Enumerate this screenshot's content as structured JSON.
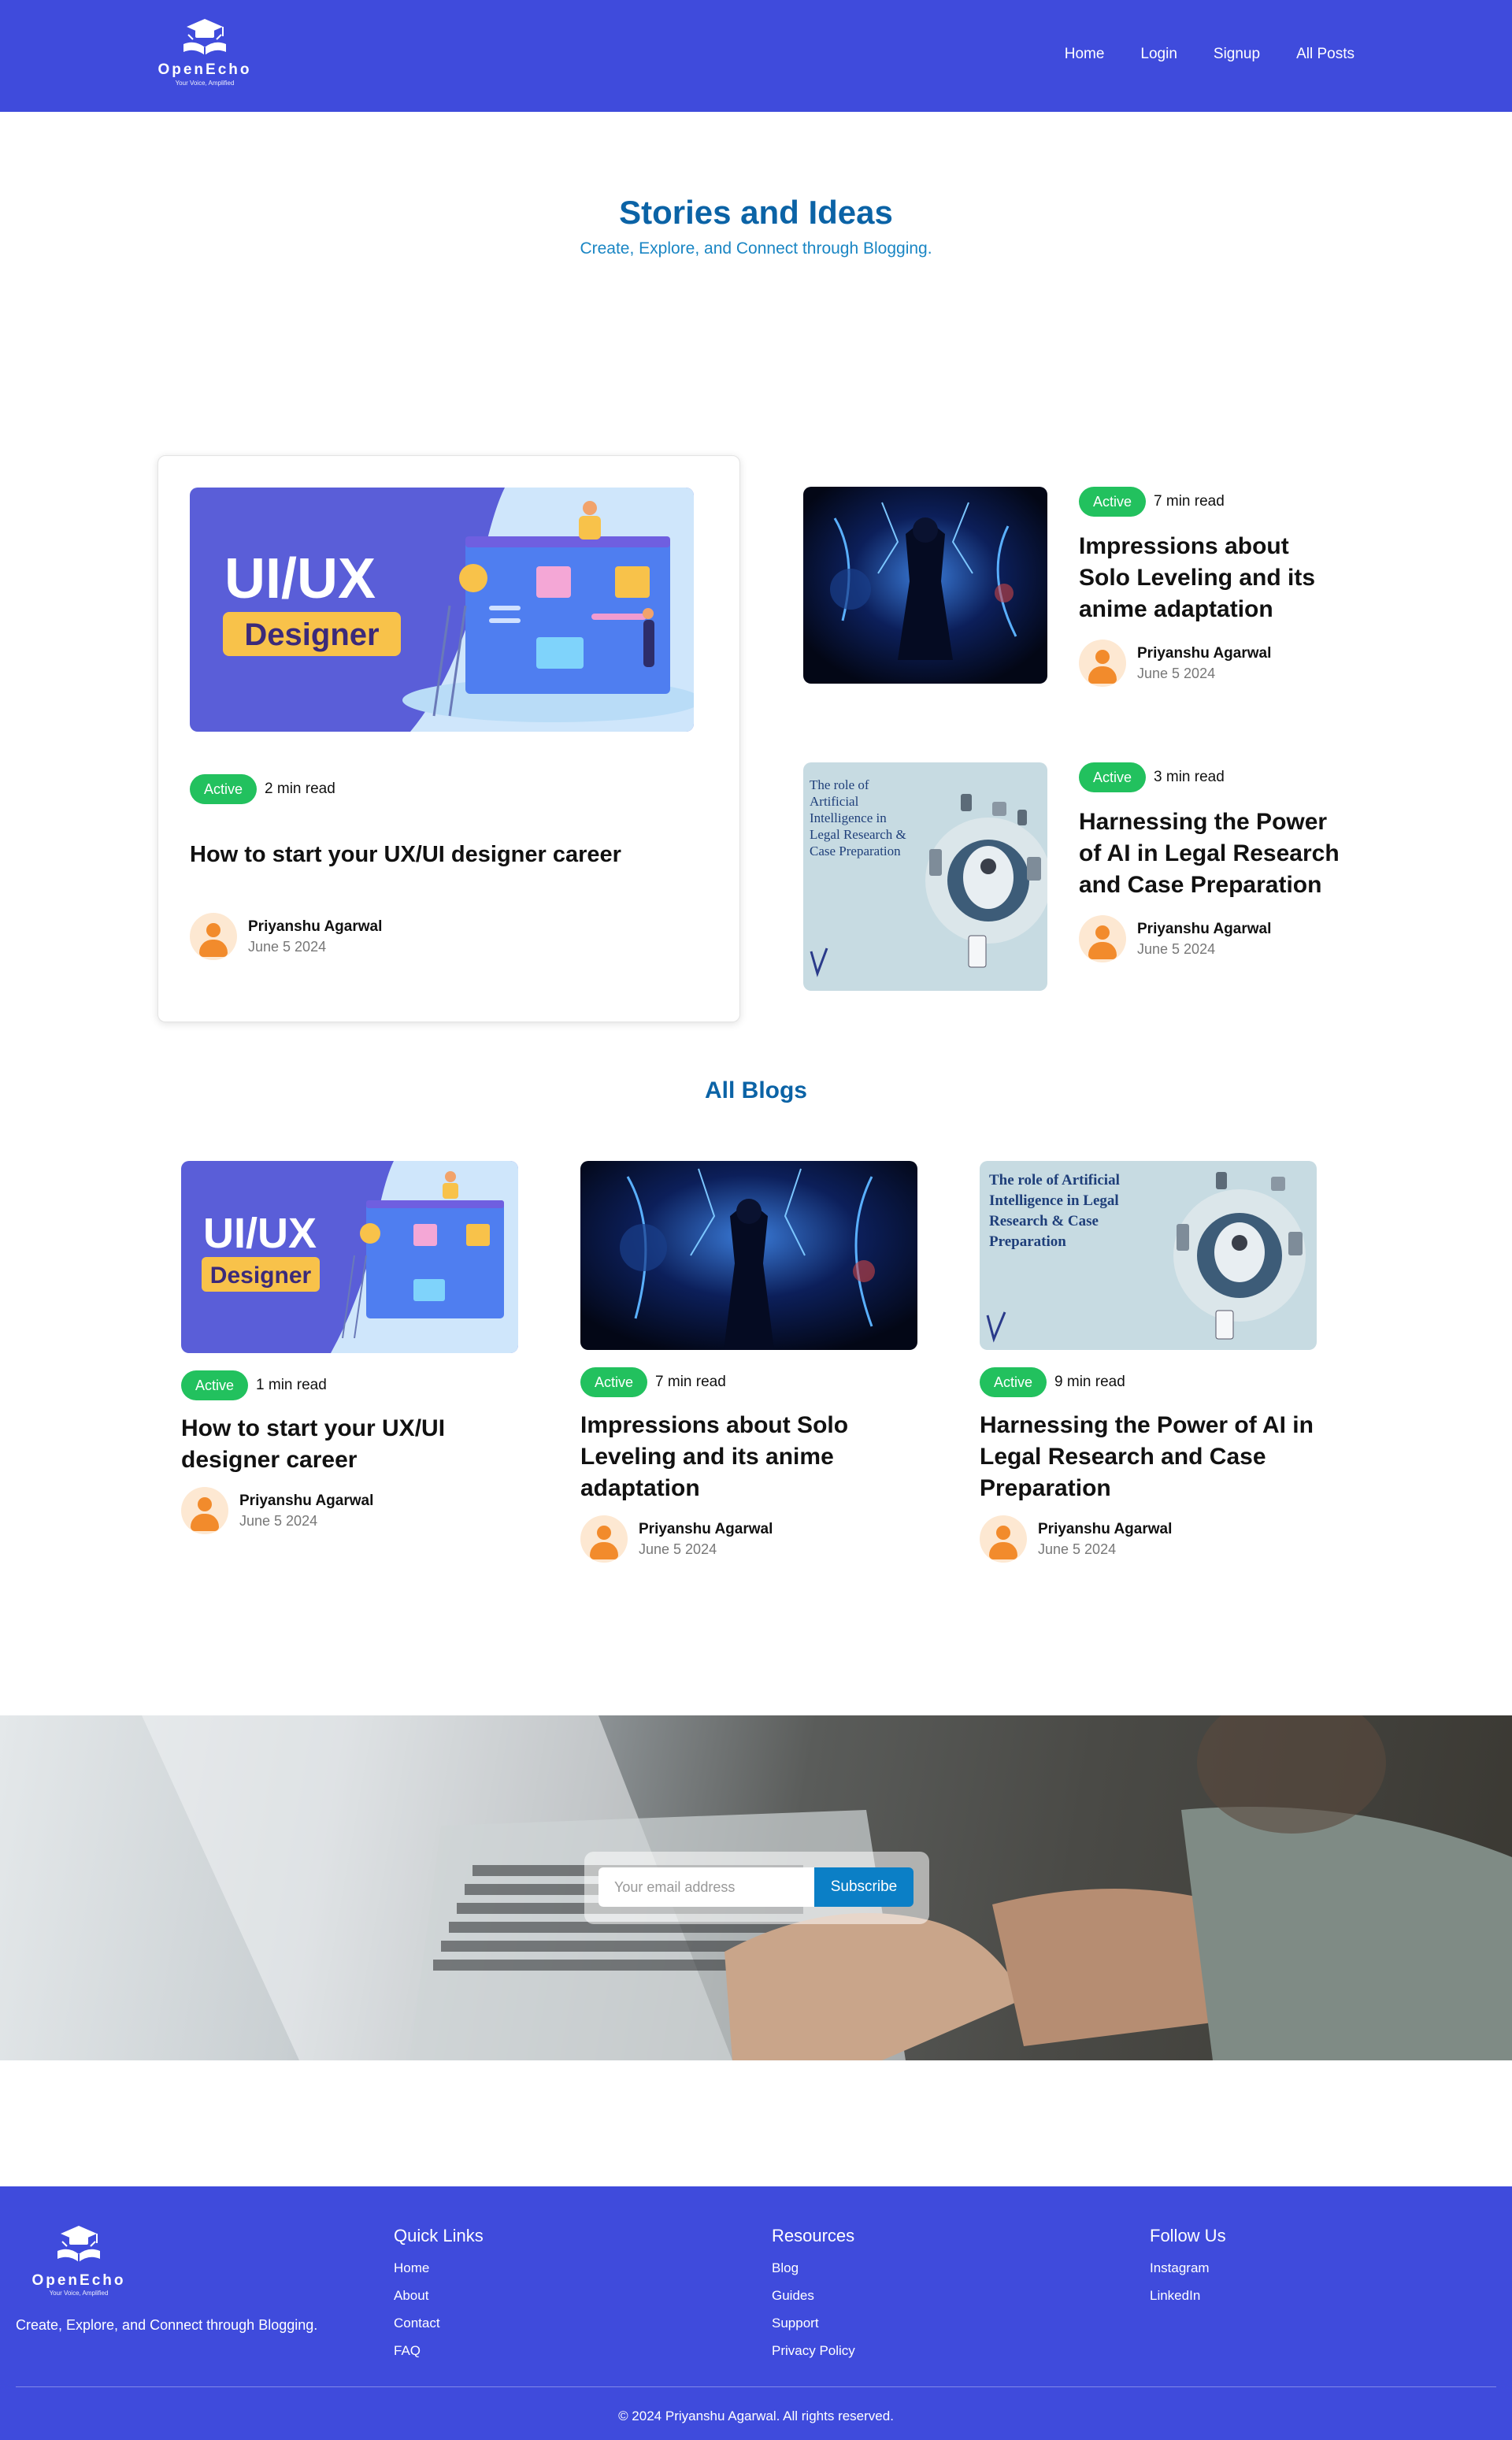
{
  "header": {
    "logo_name": "OpenEcho",
    "logo_tagline": "Your Voice, Amplified",
    "nav": [
      "Home",
      "Login",
      "Signup",
      "All Posts"
    ]
  },
  "hero": {
    "title": "Stories and Ideas",
    "subtitle": "Create, Explore, and Connect through Blogging."
  },
  "featured": {
    "main": {
      "image_text_1": "UI/UX",
      "image_text_2": "Designer",
      "badge": "Active",
      "read_time": "2 min read",
      "title": "How to start your UX/UI designer career",
      "author": "Priyanshu Agarwal",
      "date": "June 5 2024"
    },
    "side": [
      {
        "badge": "Active",
        "read_time": "7 min read",
        "title": "Impressions about Solo Leveling and its anime adaptation",
        "author": "Priyanshu Agarwal",
        "date": "June 5 2024"
      },
      {
        "image_text": "The role of Artificial Intelligence in Legal Research & Case Preparation",
        "badge": "Active",
        "read_time": "3 min read",
        "title": "Harnessing the Power of AI in Legal Research and Case Preparation",
        "author": "Priyanshu Agarwal",
        "date": "June 5 2024"
      }
    ]
  },
  "all_blogs": {
    "title": "All Blogs",
    "items": [
      {
        "image_text_1": "UI/UX",
        "image_text_2": "Designer",
        "badge": "Active",
        "read_time": "1 min read",
        "title": "How to start your UX/UI designer career",
        "author": "Priyanshu Agarwal",
        "date": "June 5 2024"
      },
      {
        "badge": "Active",
        "read_time": "7 min read",
        "title": "Impressions about Solo Leveling and its anime adaptation",
        "author": "Priyanshu Agarwal",
        "date": "June 5 2024"
      },
      {
        "image_text": "The role of Artificial Intelligence in Legal Research & Case Preparation",
        "badge": "Active",
        "read_time": "9 min read",
        "title": "Harnessing the Power of AI in Legal Research and Case Preparation",
        "author": "Priyanshu Agarwal",
        "date": "June 5 2024"
      }
    ]
  },
  "newsletter": {
    "placeholder": "Your email address",
    "button": "Subscribe"
  },
  "footer": {
    "logo_name": "OpenEcho",
    "logo_tagline": "Your Voice, Amplified",
    "tagline": "Create, Explore, and Connect through Blogging.",
    "columns": [
      {
        "title": "Quick Links",
        "links": [
          "Home",
          "About",
          "Contact",
          "FAQ"
        ]
      },
      {
        "title": "Resources",
        "links": [
          "Blog",
          "Guides",
          "Support",
          "Privacy Policy"
        ]
      },
      {
        "title": "Follow Us",
        "links": [
          "Instagram",
          "LinkedIn"
        ]
      }
    ],
    "copyright": "© 2024 Priyanshu Agarwal. All rights reserved."
  },
  "colors": {
    "brand": "#3f4bdc",
    "heading": "#0b63a6",
    "badge": "#22c15e",
    "button": "#0b7fc6"
  }
}
